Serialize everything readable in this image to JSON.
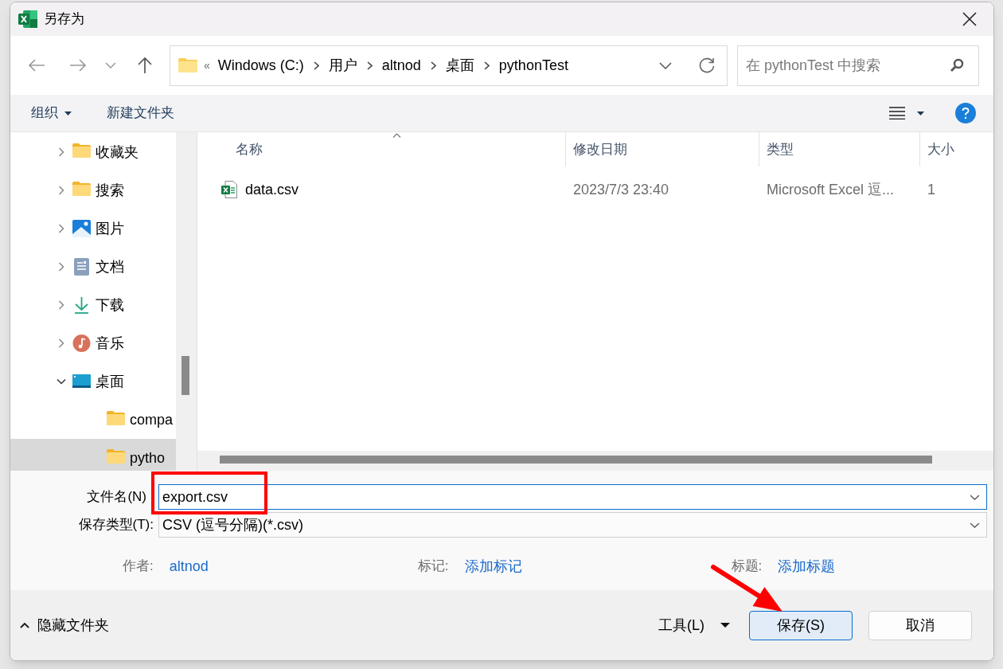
{
  "window": {
    "title": "另存为"
  },
  "address": {
    "overflow": "«",
    "crumbs": [
      "Windows (C:)",
      "用户",
      "altnod",
      "桌面",
      "pythonTest"
    ]
  },
  "search": {
    "placeholder": "在 pythonTest 中搜索"
  },
  "toolbar": {
    "organize": "组织",
    "new_folder": "新建文件夹"
  },
  "sidebar": {
    "items": [
      {
        "label": "收藏夹",
        "kind": "folder",
        "expanded": false,
        "selected": false
      },
      {
        "label": "搜索",
        "kind": "folder",
        "expanded": false,
        "selected": false
      },
      {
        "label": "图片",
        "kind": "pictures",
        "expanded": false,
        "selected": false
      },
      {
        "label": "文档",
        "kind": "documents",
        "expanded": false,
        "selected": false
      },
      {
        "label": "下载",
        "kind": "downloads",
        "expanded": false,
        "selected": false
      },
      {
        "label": "音乐",
        "kind": "music",
        "expanded": false,
        "selected": false
      },
      {
        "label": "桌面",
        "kind": "desktop",
        "expanded": true,
        "selected": false,
        "children": [
          {
            "label": "compa",
            "kind": "folder",
            "selected": false
          },
          {
            "label": "pytho",
            "kind": "folder",
            "selected": true
          }
        ]
      }
    ]
  },
  "files": {
    "columns": [
      "名称",
      "修改日期",
      "类型",
      "大小"
    ],
    "rows": [
      {
        "name": "data.csv",
        "modified": "2023/7/3 23:40",
        "type": "Microsoft Excel 逗...",
        "size": "1"
      }
    ]
  },
  "form": {
    "filename_label": "文件名(N)",
    "filename": "export.csv",
    "type_label": "保存类型(T):",
    "type_value": "CSV (逗号分隔)(*.csv)",
    "meta": [
      {
        "label": "作者:",
        "value": "altnod"
      },
      {
        "label": "标记:",
        "value": "添加标记"
      },
      {
        "label": "标题:",
        "value": "添加标题"
      }
    ]
  },
  "footer": {
    "hide_folders": "隐藏文件夹",
    "tools": "工具(L)",
    "save": "保存(S)",
    "cancel": "取消"
  }
}
